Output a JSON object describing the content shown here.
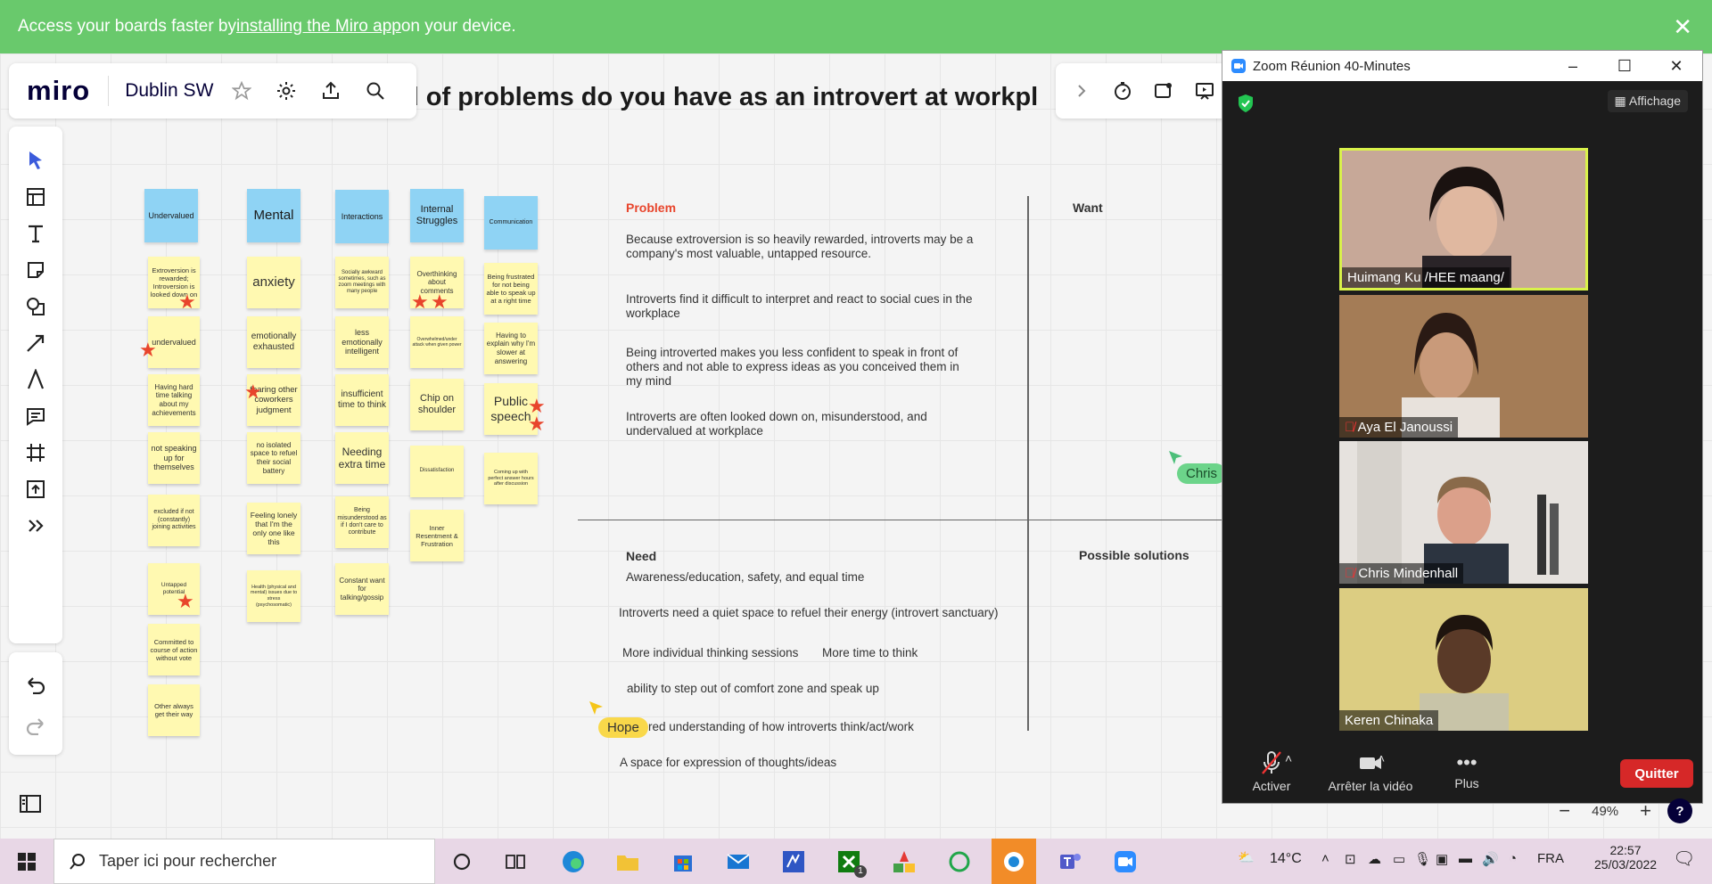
{
  "banner": {
    "text_before": "Access your boards faster by",
    "link": "installing the Miro app",
    "text_after": "on your device."
  },
  "topbar": {
    "logo": "miro",
    "board_name": "Dublin SW"
  },
  "board": {
    "title": "d of problems do you have as an introvert at workpl"
  },
  "columns": [
    {
      "header": "Undervalued",
      "notes": [
        "Extroversion is rewarded; Introversion is looked down on",
        "undervalued",
        "Having hard time talking about my achievements",
        "not speaking up for themselves",
        "excluded if not (constantly) joining activities",
        "Untapped potential",
        "Committed to course of action without vote",
        "Other always get their way"
      ]
    },
    {
      "header": "Mental",
      "notes": [
        "anxiety",
        "emotionally exhausted",
        "fearing other coworkers judgment",
        "no isolated space to refuel their social battery",
        "Feeling lonely that I'm the only one like this",
        "Health (physical and mental) issues due to stress (psychosomatic)"
      ]
    },
    {
      "header": "Interactions",
      "notes": [
        "Socially awkward sometimes, such as zoom meetings with many people",
        "less emotionally intelligent",
        "insufficient time to think",
        "Needing extra time",
        "Being misunderstood as if I don't care to contribute",
        "Constant want for talking/gossip"
      ]
    },
    {
      "header": "Internal Struggles",
      "notes": [
        "Overthinking about comments",
        "Overwhelmed/under attack when given power",
        "Chip on shoulder",
        "Dissatisfaction",
        "Inner Resentment & Frustration"
      ]
    },
    {
      "header": "Communication",
      "notes": [
        "Being frustrated for not being able to speak up at a right time",
        "Having to explain why I'm slower at answering",
        "Public speech",
        "Coming up with perfect answer hours after discussion"
      ]
    }
  ],
  "quadrants": {
    "problem_title": "Problem",
    "problems": [
      "Because extroversion is so heavily rewarded, introverts may be a company's most valuable, untapped resource.",
      "Introverts find it difficult to interpret and react to social cues in the workplace",
      "Being introverted makes you less confident to speak in front of others and not able to express ideas as you conceived them in my mind",
      "Introverts are often looked down on, misunderstood, and undervalued at workplace"
    ],
    "want_title": "Want",
    "need_title": "Need",
    "needs": [
      "Awareness/education, safety, and equal time",
      "Introverts need a quiet space to refuel their energy (introvert sanctuary)",
      "More individual thinking sessions",
      "More time to think",
      "ability to step out of comfort zone and speak up",
      "red understanding of how introverts think/act/work",
      "A space for expression of thoughts/ideas"
    ],
    "solutions_title": "Possible solutions"
  },
  "cursors": {
    "chris": "Chris",
    "hope": "Hope"
  },
  "zoom": {
    "title": "Zoom Réunion 40-Minutes",
    "view_label": "Affichage",
    "participants": [
      "Huimang Ku /HEE maang/",
      "Aya El Janoussi",
      "Chris Mindenhall",
      "Keren Chinaka"
    ],
    "mute_label": "Activer",
    "video_label": "Arrêter la vidéo",
    "more_label": "Plus",
    "quit_label": "Quitter"
  },
  "zoom_level": "49%",
  "taskbar": {
    "search_placeholder": "Taper ici pour rechercher",
    "weather": "14°C",
    "lang": "FRA",
    "time": "22:57",
    "date": "25/03/2022",
    "teams_badge": "1"
  },
  "colors": {
    "banner": "#69c96c",
    "sticky": "#fff9b1",
    "header_note": "#8fd3f4",
    "star": "#e8452c",
    "problem_title": "#e8452c",
    "quit": "#d62828"
  }
}
